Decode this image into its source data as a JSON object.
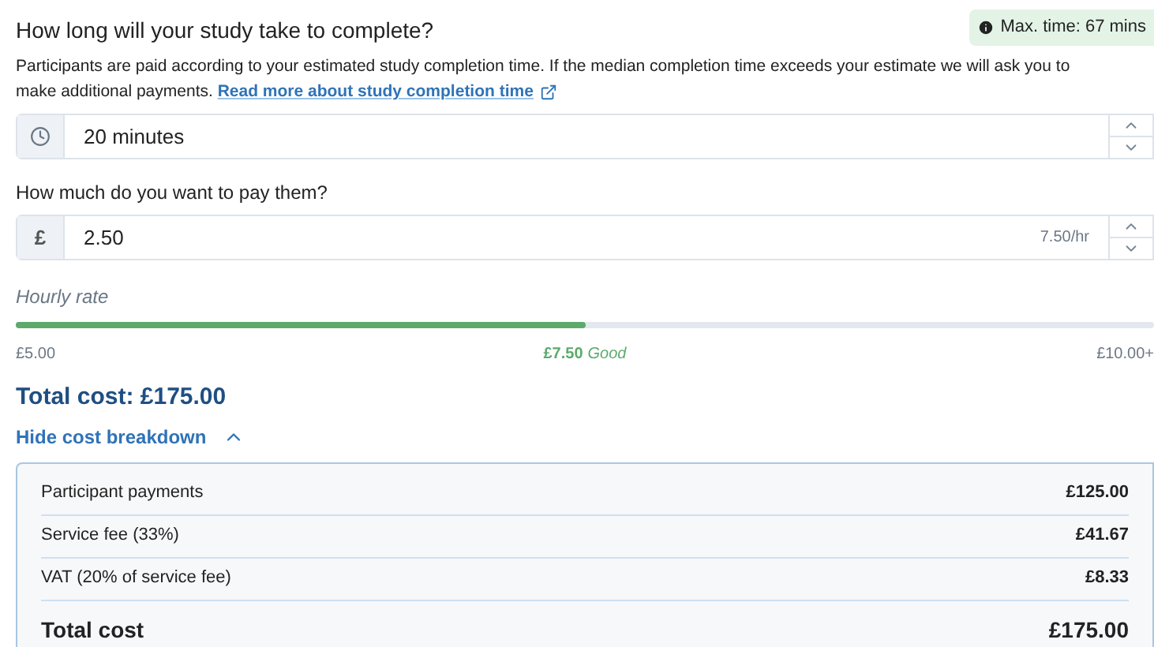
{
  "duration": {
    "question": "How long will your study take to complete?",
    "badge": "Max. time: 67 mins",
    "description": "Participants are paid according to your estimated study completion time. If the median completion time exceeds your estimate we will ask you to make additional payments.",
    "link": "Read more about study completion time",
    "value": "20 minutes"
  },
  "payment": {
    "question": "How much do you want to pay them?",
    "prefix": "£",
    "value": "2.50",
    "suffix": "7.50/hr"
  },
  "hourly_rate": {
    "label": "Hourly rate",
    "level": 0.5,
    "min": "£5.00",
    "current": "£7.50",
    "rating": "Good",
    "max": "£10.00+"
  },
  "total": {
    "title": "Total cost: £175.00",
    "toggle": "Hide cost breakdown",
    "expanded": true
  },
  "breakdown": [
    {
      "kind": "item",
      "label": "Participant payments",
      "amount": "£125.00"
    },
    {
      "kind": "item",
      "label": "Service fee (33%)",
      "amount": "£41.67"
    },
    {
      "kind": "item",
      "label": "VAT (20% of service fee)",
      "amount": "£8.33"
    },
    {
      "kind": "total",
      "label": "Total cost",
      "amount": "£175.00"
    }
  ]
}
